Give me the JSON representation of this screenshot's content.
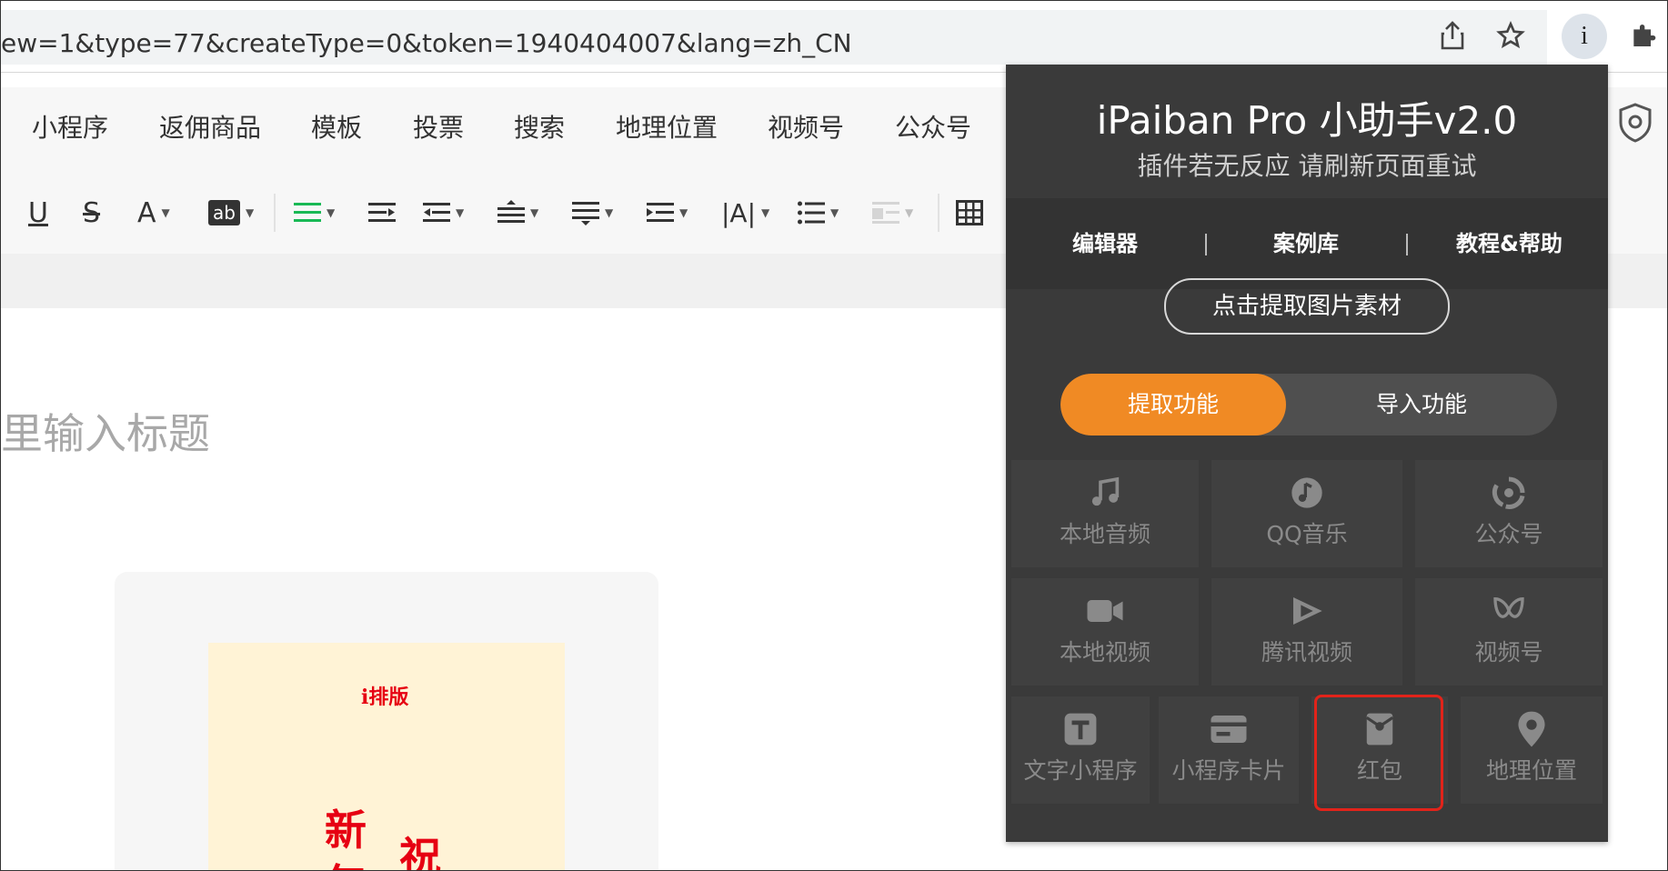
{
  "browser": {
    "url": "ew=1&type=77&createType=0&token=1940404007&lang=zh_CN",
    "icons": [
      "share-icon",
      "star-icon",
      "info-icon",
      "puzzle-icon"
    ],
    "info_label": "i"
  },
  "editor": {
    "menu": [
      "小程序",
      "返佣商品",
      "模板",
      "投票",
      "搜索",
      "地理位置",
      "视频号",
      "公众号"
    ],
    "toolbar": {
      "underline": "U",
      "strike": "S",
      "font_color": "A",
      "bg_color": "ab",
      "letter_spacing": "|A|"
    },
    "title_placeholder": "里输入标题",
    "poster": {
      "brand": "i排版",
      "chars": [
        "新",
        "祝",
        "年"
      ]
    }
  },
  "plugin": {
    "title": "iPaiban Pro 小助手v2.0",
    "subtitle": "插件若无反应 请刷新页面重试",
    "links": [
      "编辑器",
      "案例库",
      "教程&帮助"
    ],
    "extract_button": "点击提取图片素材",
    "tabs": {
      "active": "提取功能",
      "inactive": "导入功能"
    },
    "features_row1": [
      {
        "label": "本地音频",
        "icon": "music-note-icon"
      },
      {
        "label": "QQ音乐",
        "icon": "qq-music-icon"
      },
      {
        "label": "公众号",
        "icon": "wechat-official-icon"
      }
    ],
    "features_row2": [
      {
        "label": "本地视频",
        "icon": "video-camera-icon"
      },
      {
        "label": "腾讯视频",
        "icon": "tencent-video-icon"
      },
      {
        "label": "视频号",
        "icon": "channels-icon"
      }
    ],
    "features_row3": [
      {
        "label": "文字小程序",
        "icon": "text-t-icon"
      },
      {
        "label": "小程序卡片",
        "icon": "card-icon"
      },
      {
        "label": "红包",
        "icon": "red-envelope-icon"
      },
      {
        "label": "地理位置",
        "icon": "location-pin-icon"
      }
    ],
    "colors": {
      "accent": "#f08a24",
      "highlight": "#e2231a",
      "panel": "#3a3a3a"
    }
  }
}
